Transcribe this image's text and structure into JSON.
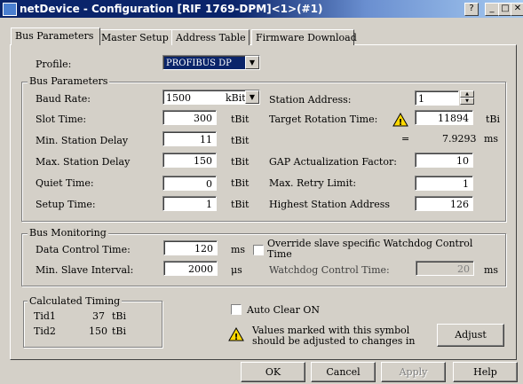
{
  "window": {
    "title": "netDevice - Configuration [RIF 1769-DPM]<1>(#1)"
  },
  "tabs": [
    "Bus Parameters",
    "Master Setup",
    "Address Table",
    "Firmware Download"
  ],
  "profile": {
    "label": "Profile:",
    "value": "PROFIBUS DP"
  },
  "bus_parameters": {
    "title": "Bus Parameters",
    "baud_rate": {
      "label": "Baud Rate:",
      "value": "1500",
      "unit": "kBit"
    },
    "slot_time": {
      "label": "Slot Time:",
      "value": "300",
      "unit": "tBit"
    },
    "min_station_delay": {
      "label": "Min. Station Delay",
      "value": "11",
      "unit": "tBit"
    },
    "max_station_delay": {
      "label": "Max. Station Delay",
      "value": "150",
      "unit": "tBit"
    },
    "quiet_time": {
      "label": "Quiet Time:",
      "value": "0",
      "unit": "tBit"
    },
    "setup_time": {
      "label": "Setup Time:",
      "value": "1",
      "unit": "tBit"
    },
    "station_address": {
      "label": "Station Address:",
      "value": "1"
    },
    "target_rotation_time": {
      "label": "Target Rotation Time:",
      "value": "11894",
      "unit": "tBi",
      "equals": "=",
      "ms_value": "7.9293",
      "ms_unit": "ms"
    },
    "gap_factor": {
      "label": "GAP Actualization Factor:",
      "value": "10"
    },
    "max_retry_limit": {
      "label": "Max. Retry Limit:",
      "value": "1"
    },
    "highest_station_address": {
      "label": "Highest Station Address",
      "value": "126"
    }
  },
  "bus_monitoring": {
    "title": "Bus Monitoring",
    "data_control_time": {
      "label": "Data Control Time:",
      "value": "120",
      "unit": "ms"
    },
    "min_slave_interval": {
      "label": "Min. Slave Interval:",
      "value": "2000",
      "unit": "μs"
    },
    "override_watchdog": {
      "label": "Override slave specific Watchdog Control Time"
    },
    "watchdog_control_time": {
      "label": "Watchdog Control Time:",
      "value": "20",
      "unit": "ms"
    }
  },
  "calculated_timing": {
    "title": "Calculated Timing",
    "tid1": {
      "label": "Tid1",
      "value": "37",
      "unit": "tBi"
    },
    "tid2": {
      "label": "Tid2",
      "value": "150",
      "unit": "tBi"
    }
  },
  "auto_clear": {
    "label": "Auto Clear ON"
  },
  "warning_note": {
    "line1": "Values marked with this symbol",
    "line2": "should be adjusted to changes in"
  },
  "buttons": {
    "adjust": "Adjust",
    "ok": "OK",
    "cancel": "Cancel",
    "apply": "Apply",
    "help": "Help"
  },
  "title_buttons": {
    "help": "?",
    "minimize": "_",
    "maximize": "□",
    "close": "✕"
  },
  "colors": {
    "titlebar": "#0a246a",
    "face": "#d4d0c8",
    "warning": "#ffd800"
  }
}
